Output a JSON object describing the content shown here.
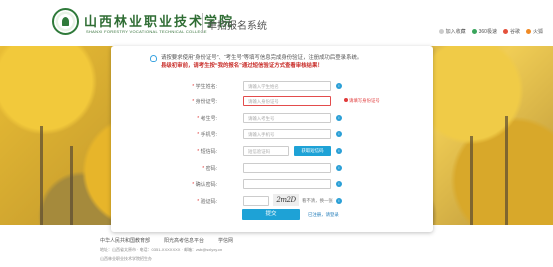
{
  "header": {
    "school_name_cn": "山西林业职业技术学院",
    "school_name_en": "SHANXI FORESTRY VOCATIONAL TECHNICAL COLLEGE",
    "system_title": "单招报名系统",
    "tools": [
      {
        "label": "加入收藏",
        "icon": "star-icon",
        "color": "#cccccc"
      },
      {
        "label": "360极速",
        "icon": "browser-360-icon",
        "color": "#3aa55c"
      },
      {
        "label": "谷歌",
        "icon": "chrome-icon",
        "color": "#e4513b"
      },
      {
        "label": "火狐",
        "icon": "firefox-icon",
        "color": "#f08a24"
      }
    ]
  },
  "notice": {
    "text": "请按要求使用“身份证号”、“考生号”等填写信息完成身份验证，注册成功后登录系统。",
    "warning": "县级初审前，请考生按“我的报名”通过短信验证方式查看审核结果！"
  },
  "form": {
    "fields": [
      {
        "label": "学生姓名",
        "required": true,
        "placeholder": "请输入学生姓名",
        "error": ""
      },
      {
        "label": "身份证号",
        "required": true,
        "placeholder": "请输入身份证号",
        "error": "请填写身份证号"
      },
      {
        "label": "考生号",
        "required": true,
        "placeholder": "请输入考生号",
        "error": ""
      },
      {
        "label": "手机号",
        "required": true,
        "placeholder": "请输入手机号",
        "error": ""
      },
      {
        "label": "短信码",
        "required": true,
        "placeholder": "短信验证码",
        "error": ""
      },
      {
        "label": "密码",
        "required": true,
        "placeholder": "",
        "error": ""
      },
      {
        "label": "确认密码",
        "required": true,
        "placeholder": "",
        "error": ""
      },
      {
        "label": "验证码",
        "required": true,
        "placeholder": "",
        "error": ""
      }
    ],
    "sms_button": "获取短信码",
    "captcha_text": "2m2D",
    "captcha_refresh": "看不清，换一张",
    "submit": "提交",
    "login_link": "已注册，请登录"
  },
  "footer": {
    "links": [
      "中华人民共和国教育部",
      "阳光高考信息平台",
      "学信网"
    ],
    "info": "地址：山西省太原市 · 电话：0351-XXXXXXX · 邮箱：zsb@sxlyxy.cn",
    "copyright": "山西林业职业技术学院招生办"
  }
}
